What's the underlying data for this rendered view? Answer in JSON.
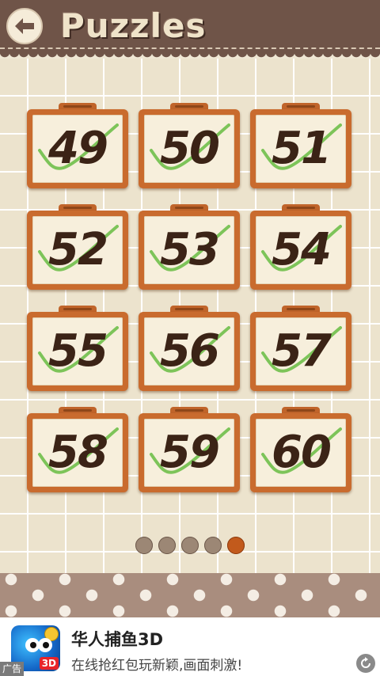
{
  "header": {
    "title": "Puzzles",
    "back_icon": "back-arrow-icon"
  },
  "levels": [
    {
      "number": "49",
      "completed": true
    },
    {
      "number": "50",
      "completed": true
    },
    {
      "number": "51",
      "completed": true
    },
    {
      "number": "52",
      "completed": true
    },
    {
      "number": "53",
      "completed": true
    },
    {
      "number": "54",
      "completed": true
    },
    {
      "number": "55",
      "completed": true
    },
    {
      "number": "56",
      "completed": true
    },
    {
      "number": "57",
      "completed": true
    },
    {
      "number": "58",
      "completed": true
    },
    {
      "number": "59",
      "completed": true
    },
    {
      "number": "60",
      "completed": true
    }
  ],
  "pager": {
    "total_pages": 5,
    "active_page": 5
  },
  "ad": {
    "title": "华人捕鱼3D",
    "subtitle": "在线抢红包玩新颖,画面刺激!",
    "label": "广告",
    "icon_badge": "3D",
    "icon_name": "fish-game-icon",
    "refresh_icon": "refresh-icon"
  },
  "colors": {
    "header_bg": "#6f5448",
    "card_frame": "#c96b2e",
    "checkmark": "#6fbf4a",
    "digits": "#3b2316",
    "dot_inactive": "#9c8775",
    "dot_active": "#c25a1c"
  }
}
